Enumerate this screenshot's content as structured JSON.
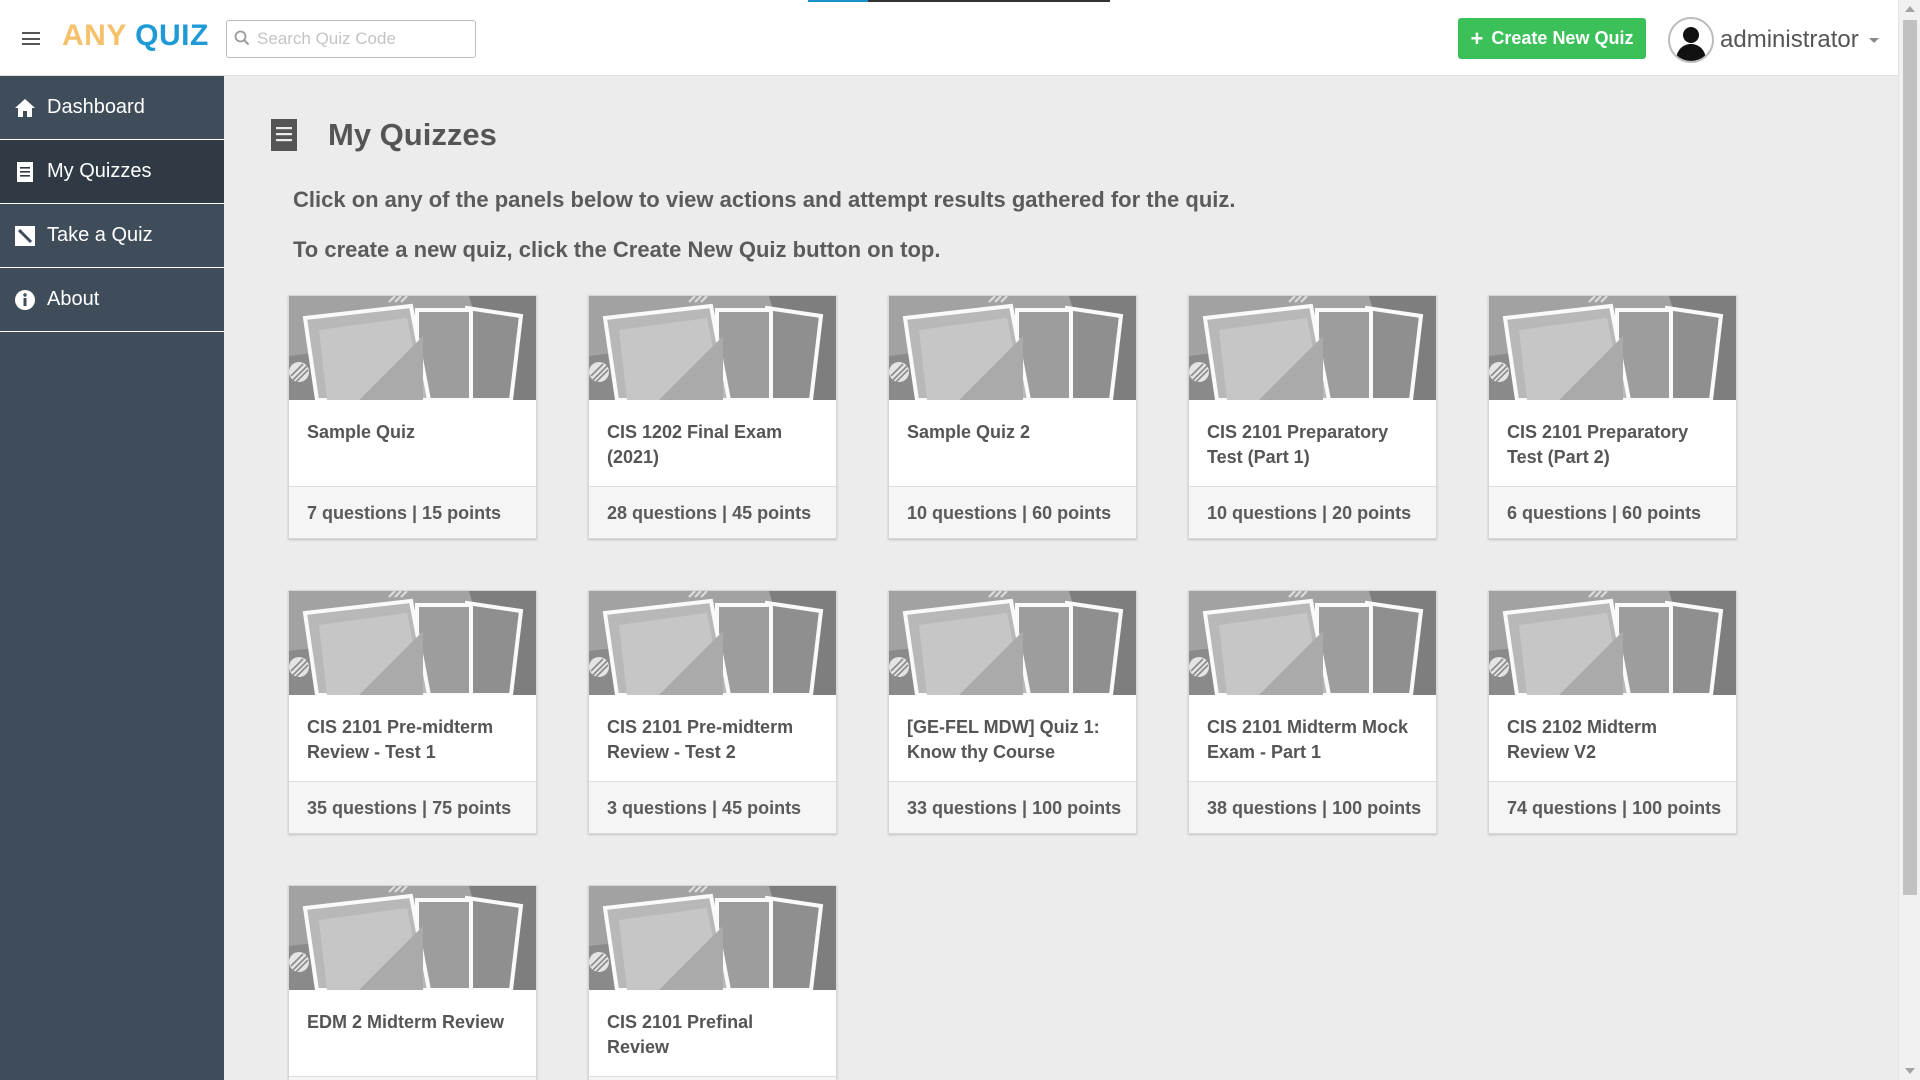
{
  "brand": {
    "any": "ANY",
    "quiz": "QUIZ"
  },
  "search": {
    "placeholder": "Search Quiz Code"
  },
  "header": {
    "create_label": "Create New Quiz",
    "username": "administrator"
  },
  "sidebar": {
    "items": [
      {
        "label": "Dashboard",
        "icon": "home-icon"
      },
      {
        "label": "My Quizzes",
        "icon": "document-icon",
        "active": true
      },
      {
        "label": "Take a Quiz",
        "icon": "pencil-icon"
      },
      {
        "label": "About",
        "icon": "info-icon"
      }
    ]
  },
  "main": {
    "title": "My Quizzes",
    "intro1": "Click on any of the panels below to view actions and attempt results gathered for the quiz.",
    "intro2": "To create a new quiz, click the Create New Quiz button on top."
  },
  "quizzes": [
    {
      "title": "Sample Quiz",
      "meta": "7 questions | 15 points"
    },
    {
      "title": "CIS 1202 Final Exam (2021)",
      "meta": "28 questions | 45 points"
    },
    {
      "title": "Sample Quiz 2",
      "meta": "10 questions | 60 points"
    },
    {
      "title": "CIS 2101 Preparatory Test (Part 1)",
      "meta": "10 questions | 20 points"
    },
    {
      "title": "CIS 2101 Preparatory Test (Part 2)",
      "meta": "6 questions | 60 points"
    },
    {
      "title": "CIS 2101 Pre-midterm Review - Test 1",
      "meta": "35 questions | 75 points"
    },
    {
      "title": "CIS 2101 Pre-midterm Review - Test 2",
      "meta": "3 questions | 45 points"
    },
    {
      "title": "[GE-FEL MDW] Quiz 1: Know thy Course",
      "meta": "33 questions | 100 points"
    },
    {
      "title": "CIS 2101 Midterm Mock Exam - Part 1",
      "meta": "38 questions | 100 points"
    },
    {
      "title": "CIS 2102 Midterm Review V2",
      "meta": "74 questions | 100 points"
    },
    {
      "title": "EDM 2 Midterm Review",
      "meta": ""
    },
    {
      "title": "CIS 2101 Prefinal Review",
      "meta": ""
    }
  ],
  "colors": {
    "accent_green": "#3cc05a",
    "brand_yellow": "#f5c26b",
    "brand_blue": "#1e9bd7",
    "sidebar_bg": "#3f4d5a"
  }
}
